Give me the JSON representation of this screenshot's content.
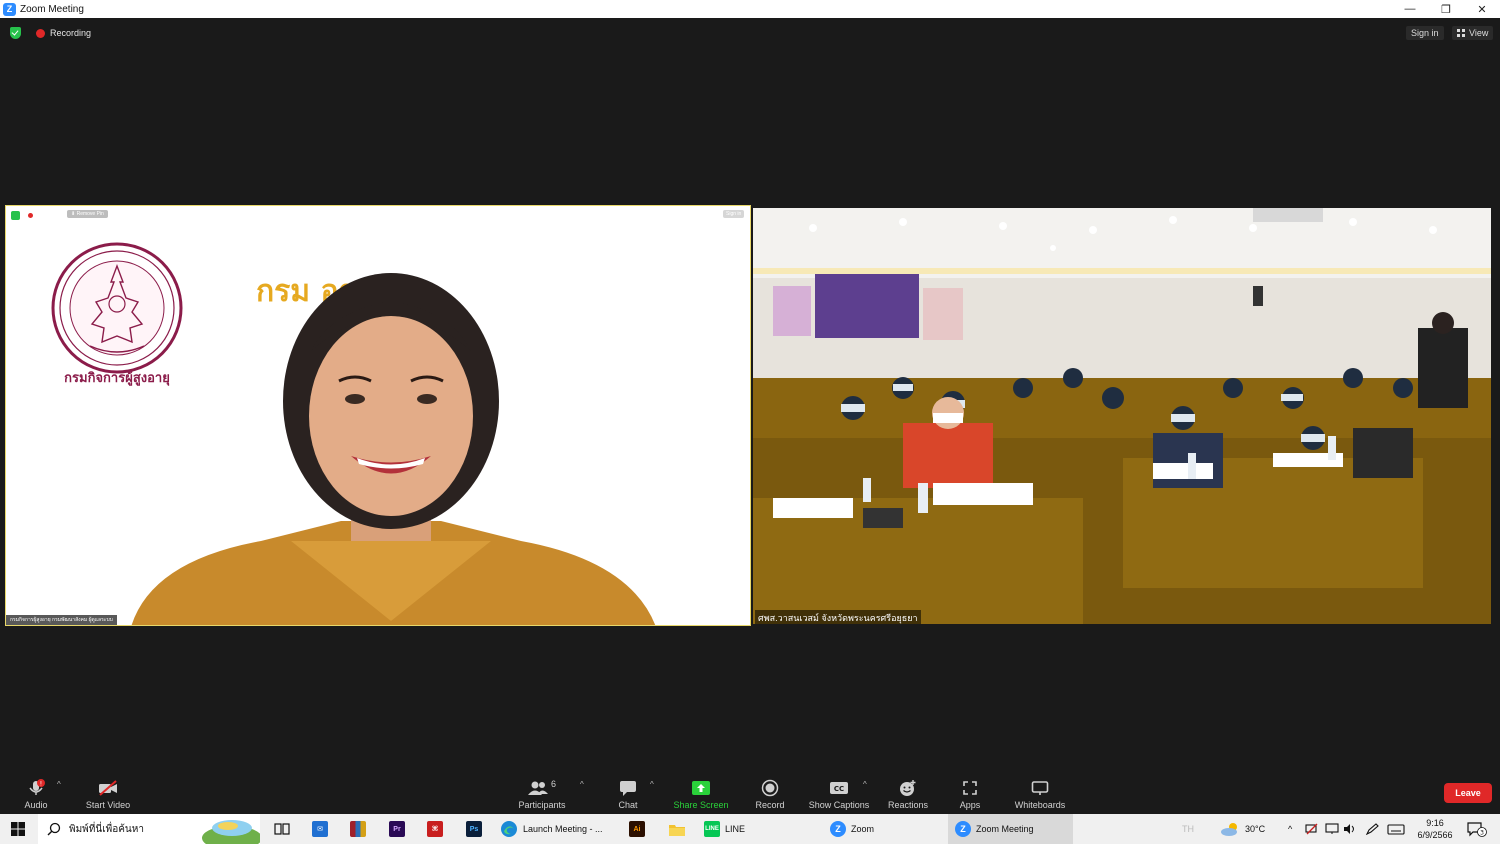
{
  "window": {
    "title": "Zoom Meeting",
    "minimize": "—",
    "restore": "❐",
    "close": "✕"
  },
  "topbar": {
    "recording": "Recording",
    "sign_in": "Sign in",
    "view": "View"
  },
  "tile1": {
    "remove_pin": "Remove Pin",
    "sign_in": "Sign in",
    "org_text": "กรม           อายุ",
    "seal_text": "กรมกิจการผู้สูงอายุ",
    "name": "กรมกิจการผู้สูงอายุ กรมพัฒนาสังคม ผู้ดูแลระบบ"
  },
  "tile2": {
    "name": "ศพส.วาสนเวสม์ จังหวัดพระนครศรีอยุธยา"
  },
  "toolbar": {
    "audio": "Audio",
    "start_video": "Start Video",
    "participants": "Participants",
    "participant_count": "6",
    "chat": "Chat",
    "share_screen": "Share Screen",
    "record": "Record",
    "show_captions": "Show Captions",
    "reactions": "Reactions",
    "apps": "Apps",
    "whiteboards": "Whiteboards",
    "leave": "Leave",
    "cc": "CC",
    "audio_badge": "!"
  },
  "taskbar": {
    "search_placeholder": "พิมพ์ที่นี่เพื่อค้นหา",
    "launch_meeting": "Launch Meeting - ...",
    "line": "LINE",
    "zoom": "Zoom",
    "zoom_meeting": "Zoom Meeting",
    "pr": "Pr",
    "ps": "Ps",
    "ai": "Ai",
    "lang": "TH",
    "temperature": "30°C",
    "time": "9:16",
    "date": "6/9/2566",
    "notification_count": "3"
  },
  "colors": {
    "zoom_blue": "#2d8cff",
    "leave_red": "#e02828",
    "share_green": "#2ad13a",
    "org_gold": "#e6a920",
    "seal_maroon": "#8b1c4a"
  }
}
